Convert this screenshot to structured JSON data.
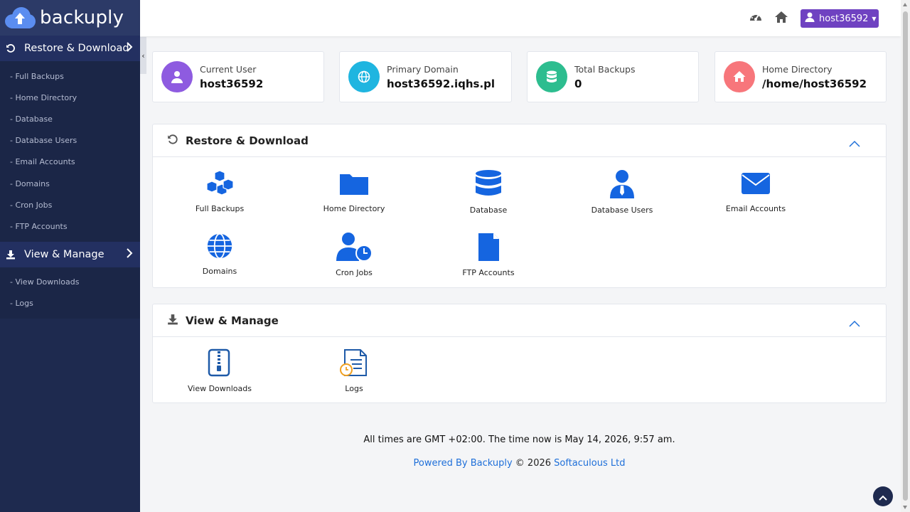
{
  "brand": {
    "name": "backuply",
    "icon": "cloud-upload-icon"
  },
  "sidebar": {
    "sections": [
      {
        "title": "Restore & Download",
        "icon": "restore-icon",
        "items": [
          "- Full Backups",
          "- Home Directory",
          "- Database",
          "- Database Users",
          "- Email Accounts",
          "- Domains",
          "- Cron Jobs",
          "- FTP Accounts"
        ]
      },
      {
        "title": "View & Manage",
        "icon": "download-icon",
        "items": [
          "- View Downloads",
          "- Logs"
        ]
      }
    ],
    "collapse_label": "‹"
  },
  "topbar": {
    "icons": [
      "dashboard-icon",
      "home-icon"
    ],
    "user": "host36592",
    "user_icon": "user-icon"
  },
  "cards": [
    {
      "label": "Current User",
      "value": "host36592",
      "color": "#8e5be0",
      "icon": "user-icon"
    },
    {
      "label": "Primary Domain",
      "value": "host36592.iqhs.pl",
      "color": "#1fb5e0",
      "icon": "globe-icon"
    },
    {
      "label": "Total Backups",
      "value": "0",
      "color": "#2dbd8f",
      "icon": "database-icon"
    },
    {
      "label": "Home Directory",
      "value": "/home/host36592",
      "color": "#f7767b",
      "icon": "home-icon"
    }
  ],
  "panels": {
    "restore": {
      "title": "Restore & Download",
      "tiles": [
        "Full Backups",
        "Home Directory",
        "Database",
        "Database Users",
        "Email Accounts",
        "Domains",
        "Cron Jobs",
        "FTP Accounts"
      ]
    },
    "manage": {
      "title": "View & Manage",
      "tiles": [
        "View Downloads",
        "Logs"
      ]
    }
  },
  "footer": {
    "time": "All times are GMT +02:00. The time now is May 14, 2026, 9:57 am.",
    "powered_link": "Powered By Backuply",
    "copyright": " © 2026 ",
    "company_link": "Softaculous Ltd"
  },
  "colors": {
    "accent": "#1e6fd9",
    "sidebar": "#1e2a4f",
    "user_button": "#6f42c1"
  }
}
